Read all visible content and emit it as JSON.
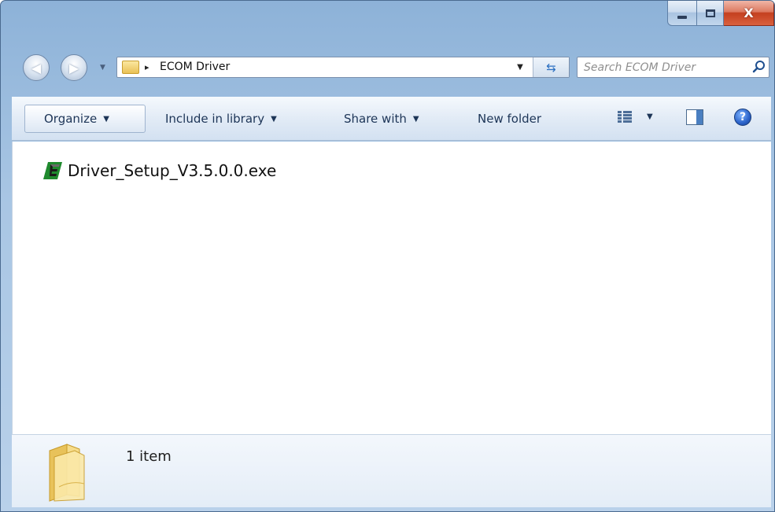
{
  "window": {
    "caption": {
      "minimize_icon": "minimize-icon",
      "maximize_icon": "maximize-icon",
      "close_label": "X"
    }
  },
  "nav": {
    "back_icon": "back-arrow-icon",
    "forward_icon": "forward-arrow-icon",
    "breadcrumb_arrow": "▸",
    "location": "ECOM Driver",
    "refresh_icon": "refresh-icon"
  },
  "search": {
    "placeholder": "Search ECOM Driver",
    "value": ""
  },
  "toolbar": {
    "organize": "Organize",
    "include_in_library": "Include in library",
    "share_with": "Share with",
    "new_folder": "New folder",
    "help_label": "?"
  },
  "files": [
    {
      "name": "Driver_Setup_V3.5.0.0.exe",
      "icon": "exe-app-icon"
    }
  ],
  "details": {
    "count": "1 item"
  },
  "colors": {
    "frame": "#a9c6e4",
    "toolbar": "#dde7f3",
    "close": "#c4401f",
    "exe_icon_green": "#1f8a2e"
  }
}
